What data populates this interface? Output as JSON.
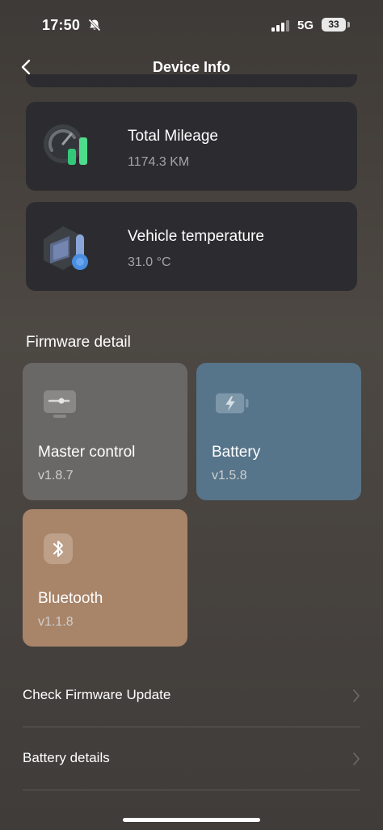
{
  "status_bar": {
    "time": "17:50",
    "network": "5G",
    "battery": "33"
  },
  "nav": {
    "title": "Device Info"
  },
  "stats": [
    {
      "title": "Total Mileage",
      "value": "1174.3 KM",
      "icon": "speedometer-icon"
    },
    {
      "title": "Vehicle temperature",
      "value": "31.0 °C",
      "icon": "thermometer-icon"
    }
  ],
  "firmware": {
    "section_title": "Firmware detail",
    "items": [
      {
        "name": "Master control",
        "version": "v1.8.7",
        "icon": "controller-icon",
        "color": "#6a6866"
      },
      {
        "name": "Battery",
        "version": "v1.5.8",
        "icon": "battery-icon",
        "color": "#56748a"
      },
      {
        "name": "Bluetooth",
        "version": "v1.1.8",
        "icon": "bluetooth-icon",
        "color": "#a88468"
      }
    ]
  },
  "menu": [
    {
      "label": "Check Firmware Update"
    },
    {
      "label": "Battery details"
    }
  ]
}
